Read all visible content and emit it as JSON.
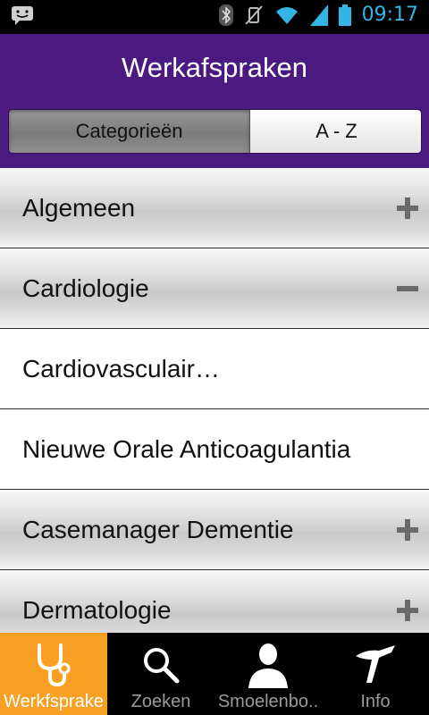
{
  "status_bar": {
    "time": "09:17"
  },
  "header": {
    "title": "Werkafspraken",
    "segments": [
      {
        "label": "Categorieën",
        "selected": true
      },
      {
        "label": "A - Z",
        "selected": false
      }
    ]
  },
  "list": {
    "items": [
      {
        "label": "Algemeen",
        "type": "category",
        "toggle": "plus"
      },
      {
        "label": "Cardiologie",
        "type": "category",
        "toggle": "minus"
      },
      {
        "label": "Cardiovasculair…",
        "type": "sub"
      },
      {
        "label": "Nieuwe Orale Anticoagulantia",
        "type": "sub"
      },
      {
        "label": "Casemanager Dementie",
        "type": "category",
        "toggle": "plus"
      },
      {
        "label": "Dermatologie",
        "type": "category",
        "toggle": "plus"
      }
    ]
  },
  "tab_bar": {
    "tabs": [
      {
        "label": "Werkfsprake",
        "icon": "stethoscope-icon",
        "active": true
      },
      {
        "label": "Zoeken",
        "icon": "search-icon",
        "active": false
      },
      {
        "label": "Smoelenbo..",
        "icon": "person-icon",
        "active": false
      },
      {
        "label": "Info",
        "icon": "info-icon",
        "active": false
      }
    ]
  },
  "colors": {
    "header_bg": "#4b1a80",
    "active_tab_bg": "#f7a023",
    "status_accent": "#33b5e5"
  }
}
